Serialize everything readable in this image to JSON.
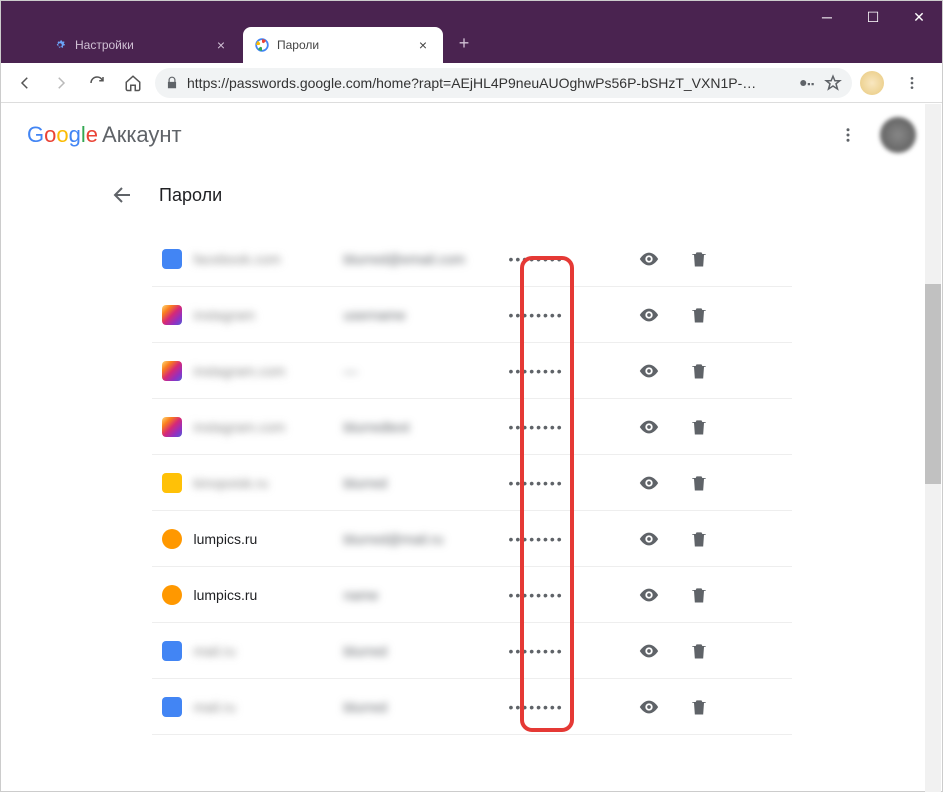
{
  "tabs": {
    "t1": {
      "label": "Настройки"
    },
    "t2": {
      "label": "Пароли"
    }
  },
  "url": "https://passwords.google.com/home?rapt=AEjHL4P9neuAUOghwPs56P-bSHzT_VXN1P-…",
  "brand": {
    "account": "Аккаунт"
  },
  "page": {
    "title": "Пароли"
  },
  "rows": [
    {
      "site": "facebook.com",
      "user": "blurred@email.com",
      "pw": "••••••••",
      "blurred": true,
      "icon": "ic-blue"
    },
    {
      "site": "instagram",
      "user": "username",
      "pw": "••••••••",
      "blurred": true,
      "icon": "ic-pink"
    },
    {
      "site": "instagram.com",
      "user": "—",
      "pw": "••••••••",
      "blurred": true,
      "icon": "ic-pink"
    },
    {
      "site": "instagram.com",
      "user": "blurredtext",
      "pw": "••••••••",
      "blurred": true,
      "icon": "ic-pink"
    },
    {
      "site": "kinopoisk.ru",
      "user": "blurred",
      "pw": "••••••••",
      "blurred": true,
      "icon": "ic-yellow"
    },
    {
      "site": "lumpics.ru",
      "user": "blurred@mail.ru",
      "pw": "••••••••",
      "blurred": false,
      "icon": "ic-orange"
    },
    {
      "site": "lumpics.ru",
      "user": "name",
      "pw": "••••••••",
      "blurred": false,
      "icon": "ic-orange"
    },
    {
      "site": "mail.ru",
      "user": "blurred",
      "pw": "••••••••",
      "blurred": true,
      "icon": "ic-blue"
    },
    {
      "site": "mail.ru",
      "user": "blurred",
      "pw": "••••••••",
      "blurred": true,
      "icon": "ic-blue"
    }
  ]
}
